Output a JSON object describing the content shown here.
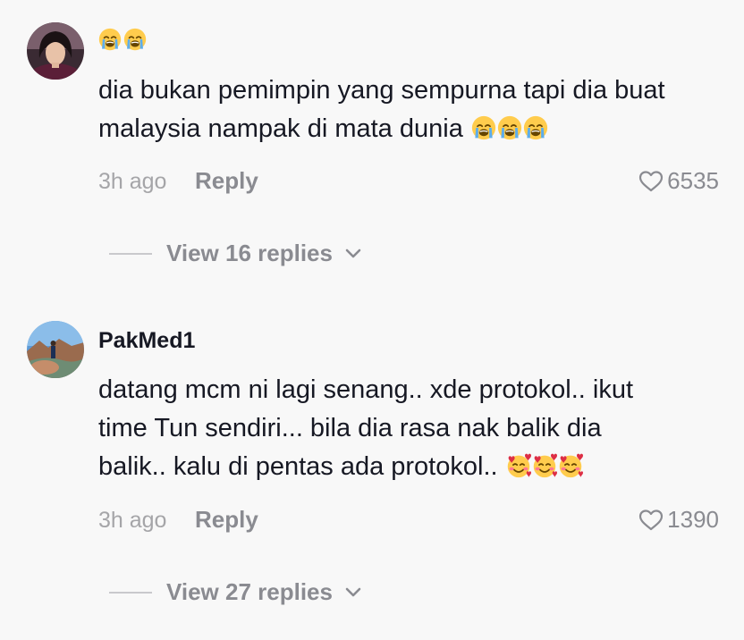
{
  "comments": [
    {
      "username": "",
      "name_emojis": [
        "loudly-crying-face",
        "loudly-crying-face"
      ],
      "text_lines": [
        "dia bukan pemimpin yang sempurna tapi dia buat",
        "malaysia nampak di mata dunia"
      ],
      "trailing_emojis": [
        "loudly-crying-face",
        "loudly-crying-face",
        "loudly-crying-face"
      ],
      "time": "3h ago",
      "reply_label": "Reply",
      "likes": "6535",
      "view_replies": "View 16 replies"
    },
    {
      "username": "PakMed1",
      "text_lines": [
        "datang mcm ni lagi senang.. xde protokol.. ikut",
        "time Tun sendiri... bila dia rasa nak balik dia",
        "balik.. kalu di pentas ada protokol.."
      ],
      "trailing_emojis": [
        "smiling-face-with-hearts",
        "smiling-face-with-hearts",
        "smiling-face-with-hearts"
      ],
      "time": "3h ago",
      "reply_label": "Reply",
      "likes": "1390",
      "view_replies": "View 27 replies"
    }
  ],
  "colors": {
    "background": "#f8f8f8",
    "text": "#161823",
    "secondary": "#8a8b91",
    "time": "#a5a5a8"
  }
}
